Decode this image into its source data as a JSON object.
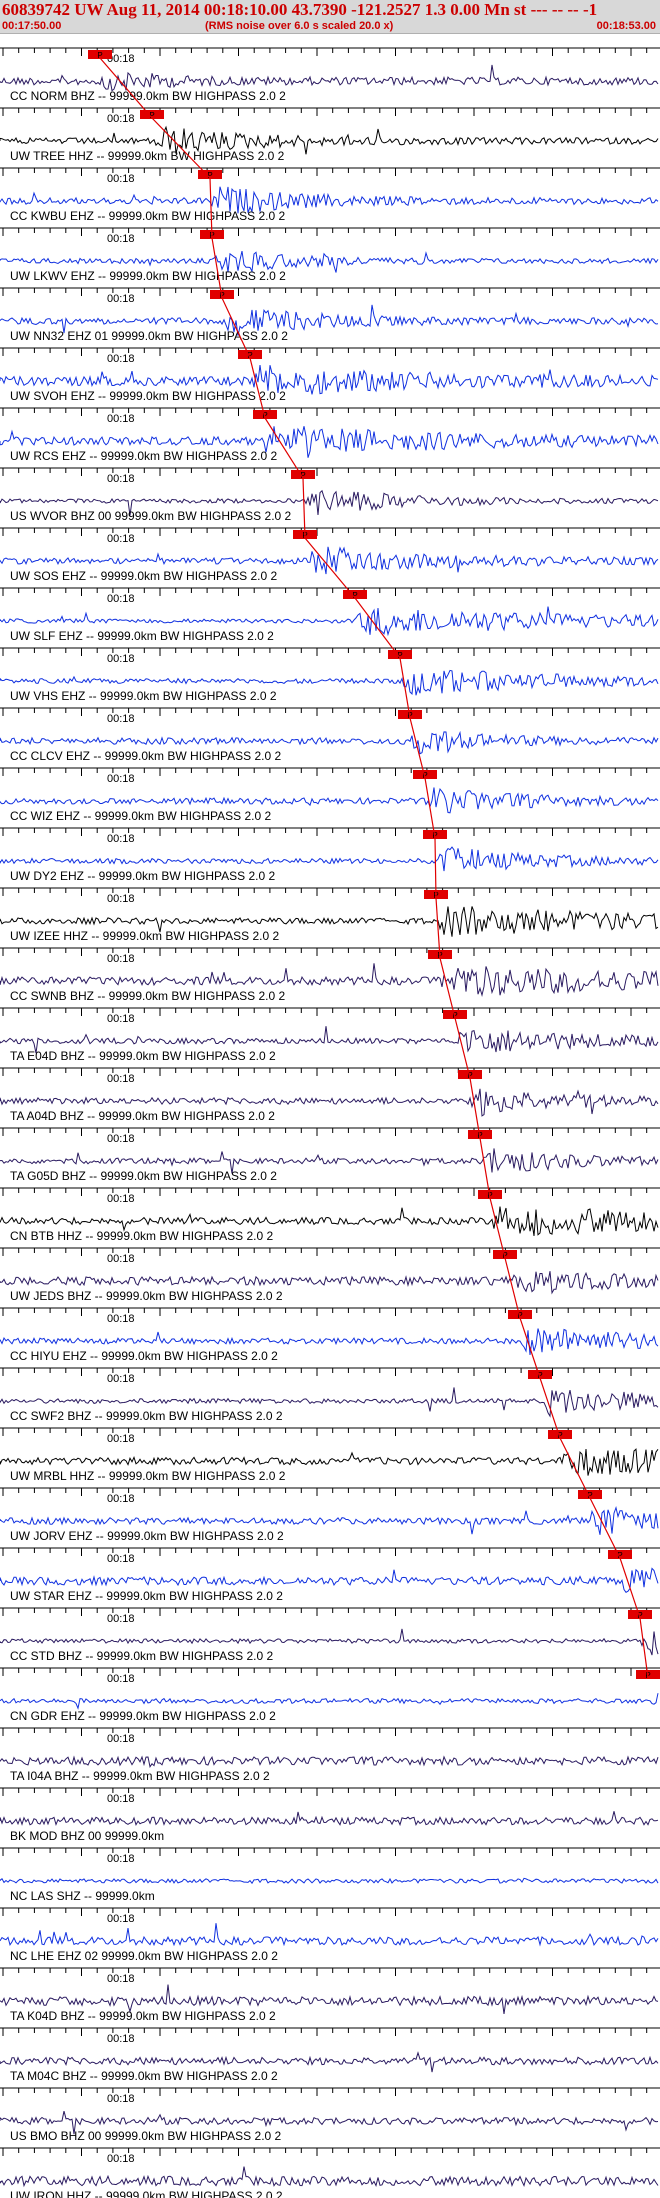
{
  "header": {
    "title": "60839742 UW Aug 11, 2014 00:18:10.00   43.7390 -121.2527  1.3 0.00 Mn st --- -- --  -1",
    "start_time": "00:17:50.00",
    "rms_note": "(RMS noise over 6.0 s scaled 20.0 x)",
    "end_time": "00:18:53.00"
  },
  "tick_label": "00:18",
  "pick_label": "P",
  "colors": {
    "header_bg": "#d8d8d8",
    "title": "#cc0000",
    "blue": "#1030e0",
    "navy": "#2a1a60",
    "black": "#000000",
    "pick": "#e00000"
  },
  "traces": [
    {
      "label": "CC NORM BHZ -- 99999.0km BW  HIGHPASS  2.0  2",
      "color": "navy"
    },
    {
      "label": "UW TREE HHZ -- 99999.0km BW  HIGHPASS  2.0  2",
      "color": "black"
    },
    {
      "label": "CC KWBU EHZ -- 99999.0km BW  HIGHPASS  2.0  2",
      "color": "blue"
    },
    {
      "label": "UW LKWV EHZ -- 99999.0km BW  HIGHPASS  2.0  2",
      "color": "blue"
    },
    {
      "label": "UW NN32 EHZ 01 99999.0km BW  HIGHPASS  2.0  2",
      "color": "blue"
    },
    {
      "label": "UW SVOH EHZ -- 99999.0km BW  HIGHPASS  2.0  2",
      "color": "blue"
    },
    {
      "label": "UW RCS EHZ -- 99999.0km BW  HIGHPASS  2.0  2",
      "color": "blue"
    },
    {
      "label": "US WVOR BHZ 00 99999.0km BW  HIGHPASS  2.0  2",
      "color": "navy"
    },
    {
      "label": "UW SOS EHZ -- 99999.0km BW  HIGHPASS  2.0  2",
      "color": "blue"
    },
    {
      "label": "UW SLF EHZ -- 99999.0km BW  HIGHPASS  2.0  2",
      "color": "blue"
    },
    {
      "label": "UW VHS EHZ -- 99999.0km BW  HIGHPASS  2.0  2",
      "color": "blue"
    },
    {
      "label": "CC CLCV EHZ -- 99999.0km BW  HIGHPASS  2.0  2",
      "color": "blue"
    },
    {
      "label": "CC WIZ EHZ -- 99999.0km BW  HIGHPASS  2.0  2",
      "color": "blue"
    },
    {
      "label": "UW DY2 EHZ -- 99999.0km BW  HIGHPASS  2.0  2",
      "color": "blue"
    },
    {
      "label": "UW IZEE HHZ -- 99999.0km BW  HIGHPASS  2.0  2",
      "color": "black"
    },
    {
      "label": "CC SWNB BHZ -- 99999.0km BW  HIGHPASS  2.0  2",
      "color": "navy"
    },
    {
      "label": "TA E04D BHZ -- 99999.0km BW  HIGHPASS  2.0  2",
      "color": "navy"
    },
    {
      "label": "TA A04D BHZ -- 99999.0km BW  HIGHPASS  2.0  2",
      "color": "navy"
    },
    {
      "label": "TA G05D BHZ -- 99999.0km BW  HIGHPASS  2.0  2",
      "color": "navy"
    },
    {
      "label": "CN BTB HHZ -- 99999.0km BW  HIGHPASS  2.0  2",
      "color": "black"
    },
    {
      "label": "UW JEDS BHZ -- 99999.0km BW  HIGHPASS  2.0  2",
      "color": "navy"
    },
    {
      "label": "CC HIYU EHZ -- 99999.0km BW  HIGHPASS  2.0  2",
      "color": "blue"
    },
    {
      "label": "CC SWF2 BHZ -- 99999.0km BW  HIGHPASS  2.0  2",
      "color": "navy"
    },
    {
      "label": "UW MRBL HHZ -- 99999.0km BW  HIGHPASS  2.0  2",
      "color": "black"
    },
    {
      "label": "UW JORV EHZ -- 99999.0km BW  HIGHPASS  2.0  2",
      "color": "blue"
    },
    {
      "label": "UW STAR EHZ -- 99999.0km BW  HIGHPASS  2.0  2",
      "color": "blue"
    },
    {
      "label": "CC STD BHZ -- 99999.0km BW  HIGHPASS  2.0  2",
      "color": "navy"
    },
    {
      "label": "CN GDR EHZ -- 99999.0km BW  HIGHPASS  2.0  2",
      "color": "blue"
    },
    {
      "label": "TA I04A BHZ -- 99999.0km BW  HIGHPASS  2.0  2",
      "color": "navy"
    },
    {
      "label": "BK MOD BHZ 00 99999.0km",
      "color": "navy"
    },
    {
      "label": "NC LAS SHZ -- 99999.0km",
      "color": "blue"
    },
    {
      "label": "NC LHE EHZ 02 99999.0km BW  HIGHPASS  2.0  2",
      "color": "blue"
    },
    {
      "label": "TA K04D BHZ -- 99999.0km BW  HIGHPASS  2.0  2",
      "color": "navy"
    },
    {
      "label": "TA M04C BHZ -- 99999.0km BW  HIGHPASS  2.0  2",
      "color": "navy"
    },
    {
      "label": "US BMO BHZ 00 99999.0km BW  HIGHPASS  2.0  2",
      "color": "navy"
    },
    {
      "label": "UW IRON HHZ -- 99999.0km BW  HIGHPASS  2.0  2",
      "color": "navy"
    }
  ]
}
